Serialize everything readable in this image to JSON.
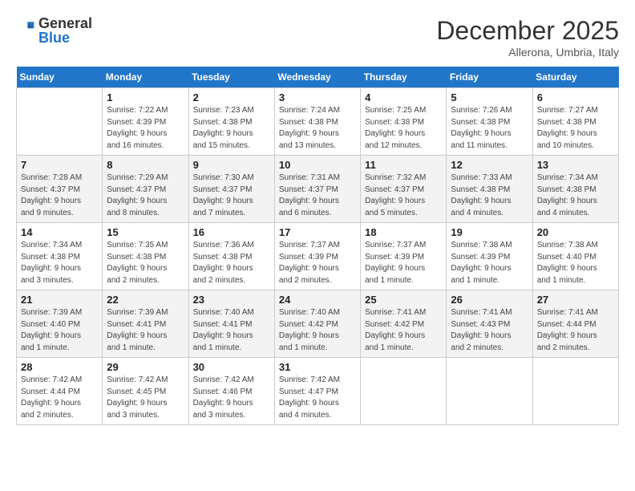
{
  "logo": {
    "general": "General",
    "blue": "Blue"
  },
  "header": {
    "month": "December 2025",
    "location": "Allerona, Umbria, Italy"
  },
  "weekdays": [
    "Sunday",
    "Monday",
    "Tuesday",
    "Wednesday",
    "Thursday",
    "Friday",
    "Saturday"
  ],
  "weeks": [
    [
      {
        "day": "",
        "info": ""
      },
      {
        "day": "1",
        "info": "Sunrise: 7:22 AM\nSunset: 4:39 PM\nDaylight: 9 hours\nand 16 minutes."
      },
      {
        "day": "2",
        "info": "Sunrise: 7:23 AM\nSunset: 4:38 PM\nDaylight: 9 hours\nand 15 minutes."
      },
      {
        "day": "3",
        "info": "Sunrise: 7:24 AM\nSunset: 4:38 PM\nDaylight: 9 hours\nand 13 minutes."
      },
      {
        "day": "4",
        "info": "Sunrise: 7:25 AM\nSunset: 4:38 PM\nDaylight: 9 hours\nand 12 minutes."
      },
      {
        "day": "5",
        "info": "Sunrise: 7:26 AM\nSunset: 4:38 PM\nDaylight: 9 hours\nand 11 minutes."
      },
      {
        "day": "6",
        "info": "Sunrise: 7:27 AM\nSunset: 4:38 PM\nDaylight: 9 hours\nand 10 minutes."
      }
    ],
    [
      {
        "day": "7",
        "info": "Sunrise: 7:28 AM\nSunset: 4:37 PM\nDaylight: 9 hours\nand 9 minutes."
      },
      {
        "day": "8",
        "info": "Sunrise: 7:29 AM\nSunset: 4:37 PM\nDaylight: 9 hours\nand 8 minutes."
      },
      {
        "day": "9",
        "info": "Sunrise: 7:30 AM\nSunset: 4:37 PM\nDaylight: 9 hours\nand 7 minutes."
      },
      {
        "day": "10",
        "info": "Sunrise: 7:31 AM\nSunset: 4:37 PM\nDaylight: 9 hours\nand 6 minutes."
      },
      {
        "day": "11",
        "info": "Sunrise: 7:32 AM\nSunset: 4:37 PM\nDaylight: 9 hours\nand 5 minutes."
      },
      {
        "day": "12",
        "info": "Sunrise: 7:33 AM\nSunset: 4:38 PM\nDaylight: 9 hours\nand 4 minutes."
      },
      {
        "day": "13",
        "info": "Sunrise: 7:34 AM\nSunset: 4:38 PM\nDaylight: 9 hours\nand 4 minutes."
      }
    ],
    [
      {
        "day": "14",
        "info": "Sunrise: 7:34 AM\nSunset: 4:38 PM\nDaylight: 9 hours\nand 3 minutes."
      },
      {
        "day": "15",
        "info": "Sunrise: 7:35 AM\nSunset: 4:38 PM\nDaylight: 9 hours\nand 2 minutes."
      },
      {
        "day": "16",
        "info": "Sunrise: 7:36 AM\nSunset: 4:38 PM\nDaylight: 9 hours\nand 2 minutes."
      },
      {
        "day": "17",
        "info": "Sunrise: 7:37 AM\nSunset: 4:39 PM\nDaylight: 9 hours\nand 2 minutes."
      },
      {
        "day": "18",
        "info": "Sunrise: 7:37 AM\nSunset: 4:39 PM\nDaylight: 9 hours\nand 1 minute."
      },
      {
        "day": "19",
        "info": "Sunrise: 7:38 AM\nSunset: 4:39 PM\nDaylight: 9 hours\nand 1 minute."
      },
      {
        "day": "20",
        "info": "Sunrise: 7:38 AM\nSunset: 4:40 PM\nDaylight: 9 hours\nand 1 minute."
      }
    ],
    [
      {
        "day": "21",
        "info": "Sunrise: 7:39 AM\nSunset: 4:40 PM\nDaylight: 9 hours\nand 1 minute."
      },
      {
        "day": "22",
        "info": "Sunrise: 7:39 AM\nSunset: 4:41 PM\nDaylight: 9 hours\nand 1 minute."
      },
      {
        "day": "23",
        "info": "Sunrise: 7:40 AM\nSunset: 4:41 PM\nDaylight: 9 hours\nand 1 minute."
      },
      {
        "day": "24",
        "info": "Sunrise: 7:40 AM\nSunset: 4:42 PM\nDaylight: 9 hours\nand 1 minute."
      },
      {
        "day": "25",
        "info": "Sunrise: 7:41 AM\nSunset: 4:42 PM\nDaylight: 9 hours\nand 1 minute."
      },
      {
        "day": "26",
        "info": "Sunrise: 7:41 AM\nSunset: 4:43 PM\nDaylight: 9 hours\nand 2 minutes."
      },
      {
        "day": "27",
        "info": "Sunrise: 7:41 AM\nSunset: 4:44 PM\nDaylight: 9 hours\nand 2 minutes."
      }
    ],
    [
      {
        "day": "28",
        "info": "Sunrise: 7:42 AM\nSunset: 4:44 PM\nDaylight: 9 hours\nand 2 minutes."
      },
      {
        "day": "29",
        "info": "Sunrise: 7:42 AM\nSunset: 4:45 PM\nDaylight: 9 hours\nand 3 minutes."
      },
      {
        "day": "30",
        "info": "Sunrise: 7:42 AM\nSunset: 4:46 PM\nDaylight: 9 hours\nand 3 minutes."
      },
      {
        "day": "31",
        "info": "Sunrise: 7:42 AM\nSunset: 4:47 PM\nDaylight: 9 hours\nand 4 minutes."
      },
      {
        "day": "",
        "info": ""
      },
      {
        "day": "",
        "info": ""
      },
      {
        "day": "",
        "info": ""
      }
    ]
  ]
}
